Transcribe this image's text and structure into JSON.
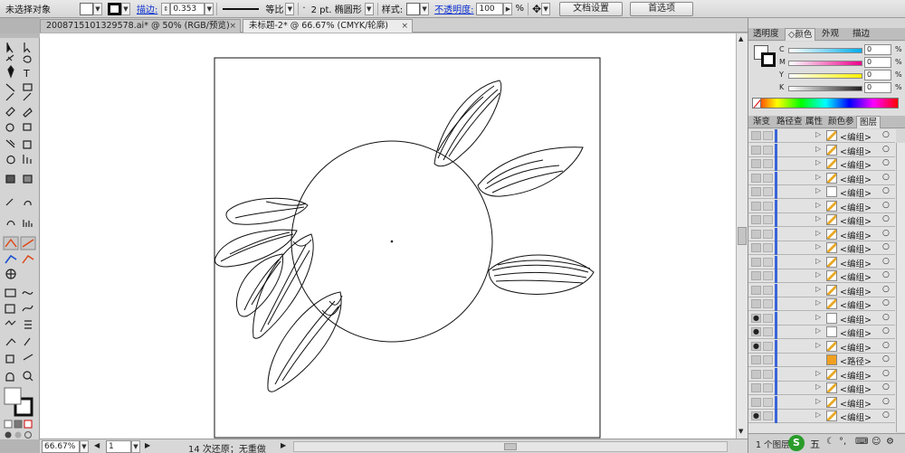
{
  "control_bar": {
    "selection_label": "未选择对象",
    "stroke_label": "描边:",
    "stroke_width": "0.353",
    "uniform_label": "等比",
    "brush_label": "2 pt. 椭圆形",
    "style_label": "样式:",
    "opacity_label": "不透明度:",
    "opacity_value": "100",
    "opacity_unit": "%",
    "doc_setup_button": "文档设置",
    "prefs_button": "首选项"
  },
  "tabs": [
    {
      "label": "2008715101329578.ai* @ 50% (RGB/预览)",
      "active": false
    },
    {
      "label": "未标题-2* @ 66.67% (CMYK/轮廓)",
      "active": true
    }
  ],
  "status": {
    "zoom": "66.67%",
    "page": "1",
    "undo_text": "14 次还原；无重做"
  },
  "color_panel": {
    "tabs": [
      "透明度",
      "颜色",
      "外观",
      "描边"
    ],
    "active_tab": 1,
    "channels": [
      {
        "label": "C",
        "value": "0",
        "color": "#00aeef"
      },
      {
        "label": "M",
        "value": "0",
        "color": "#ec008c"
      },
      {
        "label": "Y",
        "value": "0",
        "color": "#fff200"
      },
      {
        "label": "K",
        "value": "0",
        "color": "#231f20"
      }
    ],
    "unit": "%"
  },
  "layers_panel": {
    "tabs": [
      "渐变",
      "路径查",
      "属性",
      "颜色参",
      "图层"
    ],
    "active_tab": 4,
    "rows": [
      {
        "name": "<编组>",
        "eye": false,
        "thumb": "leaf"
      },
      {
        "name": "<编组>",
        "eye": false,
        "thumb": "leaf"
      },
      {
        "name": "<编组>",
        "eye": false,
        "thumb": "leaf"
      },
      {
        "name": "<编组>",
        "eye": false,
        "thumb": "leaf"
      },
      {
        "name": "<编组>",
        "eye": false,
        "thumb": "blank"
      },
      {
        "name": "<编组>",
        "eye": false,
        "thumb": "leaf"
      },
      {
        "name": "<编组>",
        "eye": false,
        "thumb": "leaf"
      },
      {
        "name": "<编组>",
        "eye": false,
        "thumb": "leaf"
      },
      {
        "name": "<编组>",
        "eye": false,
        "thumb": "leaf"
      },
      {
        "name": "<编组>",
        "eye": false,
        "thumb": "leaf"
      },
      {
        "name": "<编组>",
        "eye": false,
        "thumb": "leaf"
      },
      {
        "name": "<编组>",
        "eye": false,
        "thumb": "leaf"
      },
      {
        "name": "<编组>",
        "eye": false,
        "thumb": "leaf"
      },
      {
        "name": "<编组>",
        "eye": true,
        "thumb": "blank"
      },
      {
        "name": "<编组>",
        "eye": true,
        "thumb": "blank"
      },
      {
        "name": "<编组>",
        "eye": true,
        "thumb": "leaf"
      },
      {
        "name": "<路径>",
        "eye": false,
        "thumb": "orange"
      },
      {
        "name": "<编组>",
        "eye": false,
        "thumb": "leaf"
      },
      {
        "name": "<编组>",
        "eye": false,
        "thumb": "leaf"
      },
      {
        "name": "<编组>",
        "eye": false,
        "thumb": "leaf"
      },
      {
        "name": "<编组>",
        "eye": true,
        "thumb": "leaf"
      }
    ],
    "footer_label": "1 个图层",
    "ime_badge": "五"
  }
}
